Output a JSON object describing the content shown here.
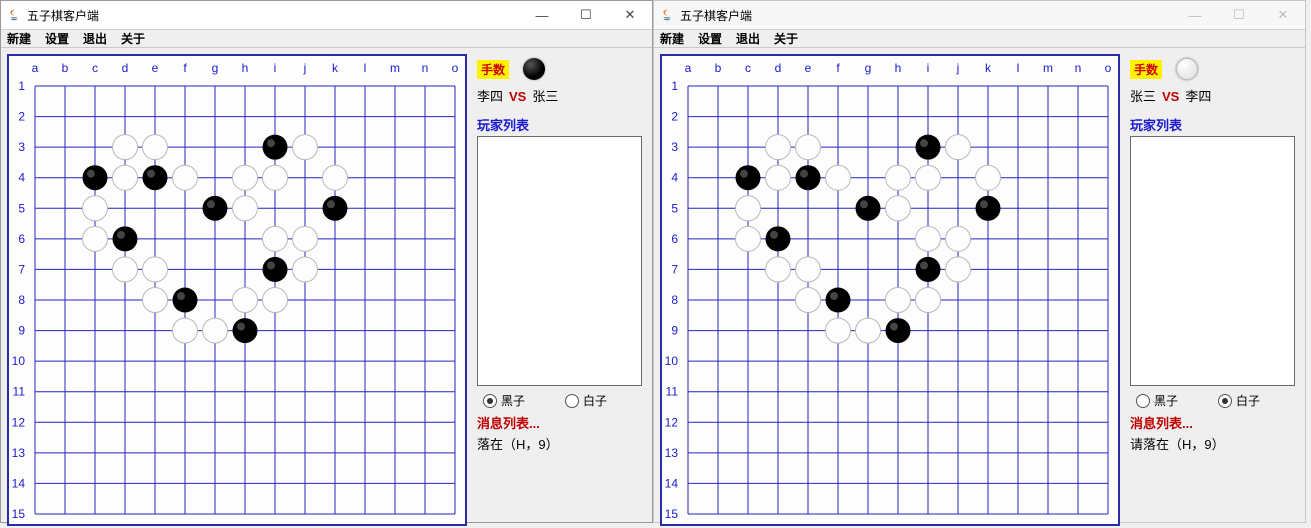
{
  "app": {
    "title": "五子棋客户端",
    "menus": [
      "新建",
      "设置",
      "退出",
      "关于"
    ]
  },
  "board": {
    "cols": [
      "a",
      "b",
      "c",
      "d",
      "e",
      "f",
      "g",
      "h",
      "i",
      "j",
      "k",
      "l",
      "m",
      "n",
      "o"
    ],
    "rows": [
      "1",
      "2",
      "3",
      "4",
      "5",
      "6",
      "7",
      "8",
      "9",
      "10",
      "11",
      "12",
      "13",
      "14",
      "15"
    ],
    "size": 15,
    "pieces": [
      {
        "c": "d",
        "r": 3,
        "color": "white"
      },
      {
        "c": "e",
        "r": 3,
        "color": "white"
      },
      {
        "c": "i",
        "r": 3,
        "color": "black"
      },
      {
        "c": "j",
        "r": 3,
        "color": "white"
      },
      {
        "c": "c",
        "r": 4,
        "color": "black"
      },
      {
        "c": "d",
        "r": 4,
        "color": "white"
      },
      {
        "c": "e",
        "r": 4,
        "color": "black"
      },
      {
        "c": "f",
        "r": 4,
        "color": "white"
      },
      {
        "c": "h",
        "r": 4,
        "color": "white"
      },
      {
        "c": "i",
        "r": 4,
        "color": "white"
      },
      {
        "c": "k",
        "r": 4,
        "color": "white"
      },
      {
        "c": "c",
        "r": 5,
        "color": "white"
      },
      {
        "c": "g",
        "r": 5,
        "color": "black"
      },
      {
        "c": "h",
        "r": 5,
        "color": "white"
      },
      {
        "c": "k",
        "r": 5,
        "color": "black"
      },
      {
        "c": "c",
        "r": 6,
        "color": "white"
      },
      {
        "c": "d",
        "r": 6,
        "color": "black"
      },
      {
        "c": "i",
        "r": 6,
        "color": "white"
      },
      {
        "c": "j",
        "r": 6,
        "color": "white"
      },
      {
        "c": "d",
        "r": 7,
        "color": "white"
      },
      {
        "c": "e",
        "r": 7,
        "color": "white"
      },
      {
        "c": "i",
        "r": 7,
        "color": "black"
      },
      {
        "c": "j",
        "r": 7,
        "color": "white"
      },
      {
        "c": "e",
        "r": 8,
        "color": "white"
      },
      {
        "c": "f",
        "r": 8,
        "color": "black"
      },
      {
        "c": "h",
        "r": 8,
        "color": "white"
      },
      {
        "c": "i",
        "r": 8,
        "color": "white"
      },
      {
        "c": "f",
        "r": 9,
        "color": "white"
      },
      {
        "c": "g",
        "r": 9,
        "color": "white"
      },
      {
        "c": "h",
        "r": 9,
        "color": "black"
      }
    ]
  },
  "side": {
    "turn_label": "手数",
    "vs": "VS",
    "player_list_title": "玩家列表",
    "msg_list_title": "消息列表...",
    "radio_black": "黑子",
    "radio_white": "白子"
  },
  "clients": [
    {
      "active": true,
      "turn_color": "black",
      "player_left": "李四",
      "player_right": "张三",
      "radio_checked": "black",
      "last_msg": "落在（H，9）"
    },
    {
      "active": false,
      "turn_color": "white",
      "player_left": "张三",
      "player_right": "李四",
      "radio_checked": "white",
      "last_msg": "请落在（H，9）"
    }
  ]
}
